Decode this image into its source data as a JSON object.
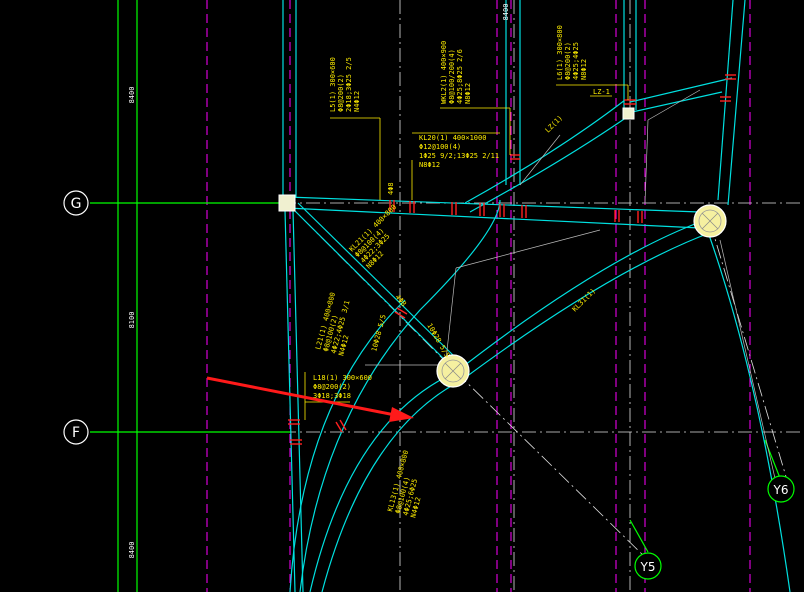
{
  "drawing": {
    "background": "#000000",
    "colors": {
      "beam": "#00e0e0",
      "axis": "#00ff00",
      "centerline": "#ffffff",
      "dashed": "#ff00ff",
      "annotation": "#ffee00",
      "rebar": "#ff2020",
      "arrow": "#ff1a1a"
    },
    "axis_labels": [
      "G",
      "F"
    ],
    "grid_labels": [
      "Y5",
      "Y6"
    ],
    "dimensions": [
      "8400",
      "8100",
      "8400",
      "8400"
    ],
    "annotations": [
      {
        "id": "l5",
        "lines": [
          "L5(1) 300×600",
          "Φ8@200(2)",
          "2Φ18;3Φ25 2/5",
          "N4Φ12"
        ]
      },
      {
        "id": "wkl2",
        "lines": [
          "WKL2(1) 400×900",
          "Φ8@100/200(4)",
          "4Φ25;8Φ25 2/6",
          "N8Φ12"
        ]
      },
      {
        "id": "l61",
        "lines": [
          "L6(1) 300×800",
          "Φ8@200(2)",
          "4Φ25;4Φ25",
          "N8Φ12"
        ]
      },
      {
        "id": "lz1",
        "lines": [
          "LZ-1"
        ]
      },
      {
        "id": "lz",
        "lines": [
          "LZ(1)"
        ]
      },
      {
        "id": "kl20",
        "lines": [
          "KL20(1) 400×1000",
          "Φ12@100(4)",
          "1Φ25 9/2;13Φ25 2/11",
          "N8Φ12"
        ]
      },
      {
        "id": "kl21",
        "lines": [
          "KL21(1) 400×800",
          "Φ8@100(4)",
          "4Φ22;3Φ25",
          "N8Φ12"
        ]
      },
      {
        "id": "kl31",
        "lines": [
          "KL31(1)"
        ]
      },
      {
        "id": "l21",
        "lines": [
          "L21(1) 400×800",
          "Φ8@100(2)",
          "4Φ22;4Φ25 3/1",
          "N4Φ12"
        ]
      },
      {
        "id": "l18",
        "lines": [
          "L18(1) 300×600",
          "Φ8@200(2)",
          "3Φ18;3Φ18"
        ]
      },
      {
        "id": "kl13",
        "lines": [
          "KL13(1) 400×800",
          "Φ8@100(4)",
          "4Φ25;6Φ25",
          "N4Φ12"
        ]
      },
      {
        "id": "s1",
        "lines": [
          "10Φ28 5/5"
        ]
      },
      {
        "id": "s2",
        "lines": [
          "10Φ28 5/5"
        ]
      },
      {
        "id": "s3",
        "lines": [
          "4Φ8"
        ]
      },
      {
        "id": "s4",
        "lines": [
          "4Φ8"
        ]
      }
    ]
  }
}
